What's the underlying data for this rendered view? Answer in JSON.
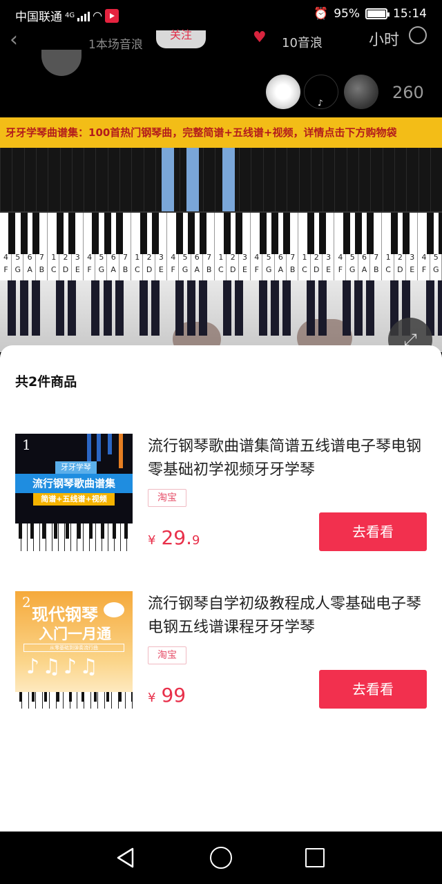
{
  "status_bar": {
    "carrier": "中国联通",
    "network": "4G",
    "battery": "95%",
    "time": "15:14"
  },
  "live_header": {
    "host_sub": "1本场音浪",
    "follow_label": "关注",
    "wave_label": "10音浪",
    "rank_label": "小时",
    "viewer_count": "260"
  },
  "video": {
    "banner_text": "牙牙学琴曲谱集：100首热门钢琴曲，完整简谱+五线谱+视频，详情点击下方购物袋",
    "key_numbers": [
      "4",
      "5",
      "6",
      "7",
      "1",
      "2",
      "3",
      "4",
      "5",
      "6",
      "7",
      "1",
      "2",
      "3",
      "4",
      "5",
      "6",
      "7",
      "1",
      "2",
      "3",
      "4",
      "5",
      "6",
      "7",
      "1",
      "2",
      "3",
      "4",
      "5",
      "6",
      "7",
      "1",
      "2",
      "3",
      "4",
      "5"
    ],
    "key_letters": [
      "F",
      "G",
      "A",
      "B",
      "C",
      "D",
      "E",
      "F",
      "G",
      "A",
      "B",
      "C",
      "D",
      "E",
      "F",
      "G",
      "A",
      "B",
      "C",
      "D",
      "E",
      "F",
      "G",
      "A",
      "B",
      "C",
      "D",
      "E",
      "F",
      "G",
      "A",
      "B",
      "C",
      "D",
      "E",
      "F",
      "G"
    ]
  },
  "sheet": {
    "title": "共2件商品",
    "products": [
      {
        "index": "1",
        "title": "流行钢琴歌曲谱集简谱五线谱电子琴电钢零基础初学视频牙牙学琴",
        "shop": "淘宝",
        "currency": "¥",
        "price_int": "29.",
        "price_dec": "9",
        "button": "去看看",
        "thumb": {
          "tag": "牙牙学琴",
          "headline": "流行钢琴歌曲谱集",
          "sub": "简谱+五线谱+视频"
        }
      },
      {
        "index": "2",
        "title": "流行钢琴自学初级教程成人零基础电子琴电钢五线谱课程牙牙学琴",
        "shop": "淘宝",
        "currency": "¥",
        "price_int": "99",
        "price_dec": "",
        "button": "去看看",
        "thumb": {
          "line1": "现代钢琴",
          "line2": "入门一月通",
          "tiny": "从零基础到弹奏流行曲",
          "notes": "♪♫♪♫"
        }
      }
    ]
  },
  "colors": {
    "accent": "#f2304e",
    "banner_bg": "#f3bd17",
    "banner_text": "#b31c1c"
  }
}
